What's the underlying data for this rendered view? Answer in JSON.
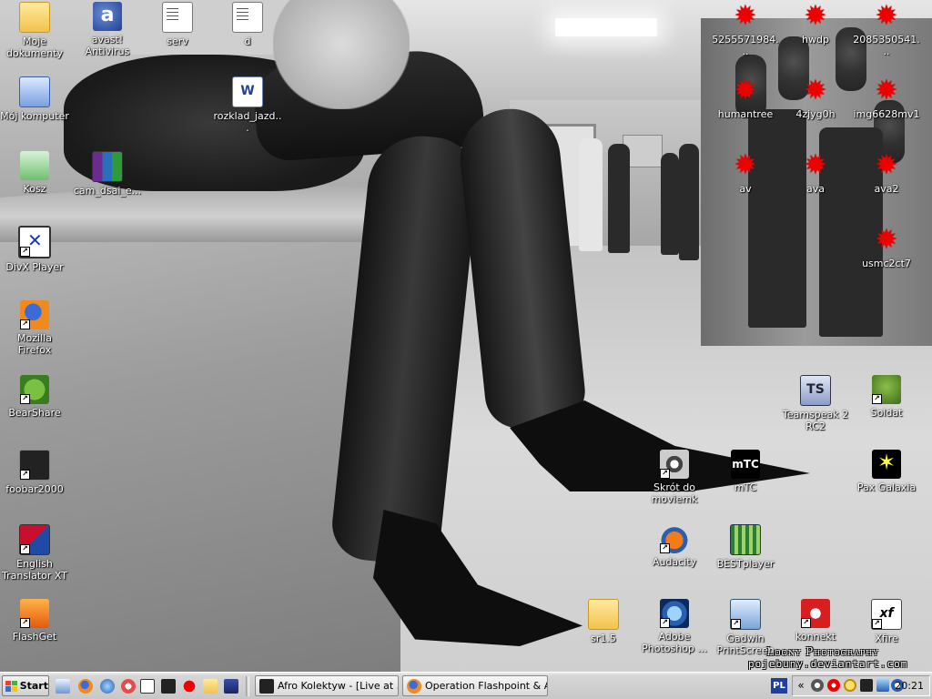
{
  "wallpaper": {
    "watermark_line1": "Loony Photography",
    "watermark_line2": "pojebuny.deviantart.com"
  },
  "icons": {
    "moje_dokumenty": "Moje dokumenty",
    "avast": "avast! Antivirus",
    "serv": "serv",
    "d": "d",
    "moj_komputer": "Mój komputer",
    "rozklad": "rozklad_jazd...",
    "kosz": "Kosz",
    "cam_dsai": "cam_dsai_e...",
    "divx": "DivX Player",
    "firefox": "Mozilla Firefox",
    "bearshare": "BearShare",
    "foobar": "foobar2000",
    "translator": "English Translator XT",
    "flashget": "FlashGet",
    "file_5255": "5255571984...",
    "hwdp": "hwdp",
    "file_2085": "2085350541...",
    "humantree": "humantree",
    "fourzjyg": "4zjyg0h",
    "img6628": "img6628mv1",
    "av": "av",
    "ava": "ava",
    "ava2": "ava2",
    "usmc": "usmc2ct7",
    "teamspeak": "Teamspeak 2 RC2",
    "soldat": "Soldat",
    "moviemk": "Skrót do moviemk",
    "mtc": "mTC",
    "pax": "Pax Galaxia",
    "audacity": "Audacity",
    "bestplayer": "BESTplayer",
    "sr15": "sr1.5",
    "photoshop": "Adobe Photoshop ...",
    "gadwin": "Gadwin PrintScreen",
    "konnekt": "konnekt",
    "xfire": "Xfire"
  },
  "icon_glyphs": {
    "avast": "a",
    "word": "W",
    "teamspeak": "TS",
    "mtc": "mTC",
    "xfire": "xf",
    "red_splat": "✹",
    "shortcut_arrow": "↗"
  },
  "taskbar": {
    "start_label": "Start",
    "tasks": [
      {
        "label": "Afro Kolektyw - [Live at ...",
        "icon": "alien-icon"
      },
      {
        "label": "Operation Flashpoint & A...",
        "icon": "firefox-icon"
      }
    ],
    "language": "PL",
    "tray_chevron": "«",
    "clock": "20:21"
  },
  "colors": {
    "accent_red": "#e00000",
    "taskbar": "#d0d0d0"
  }
}
